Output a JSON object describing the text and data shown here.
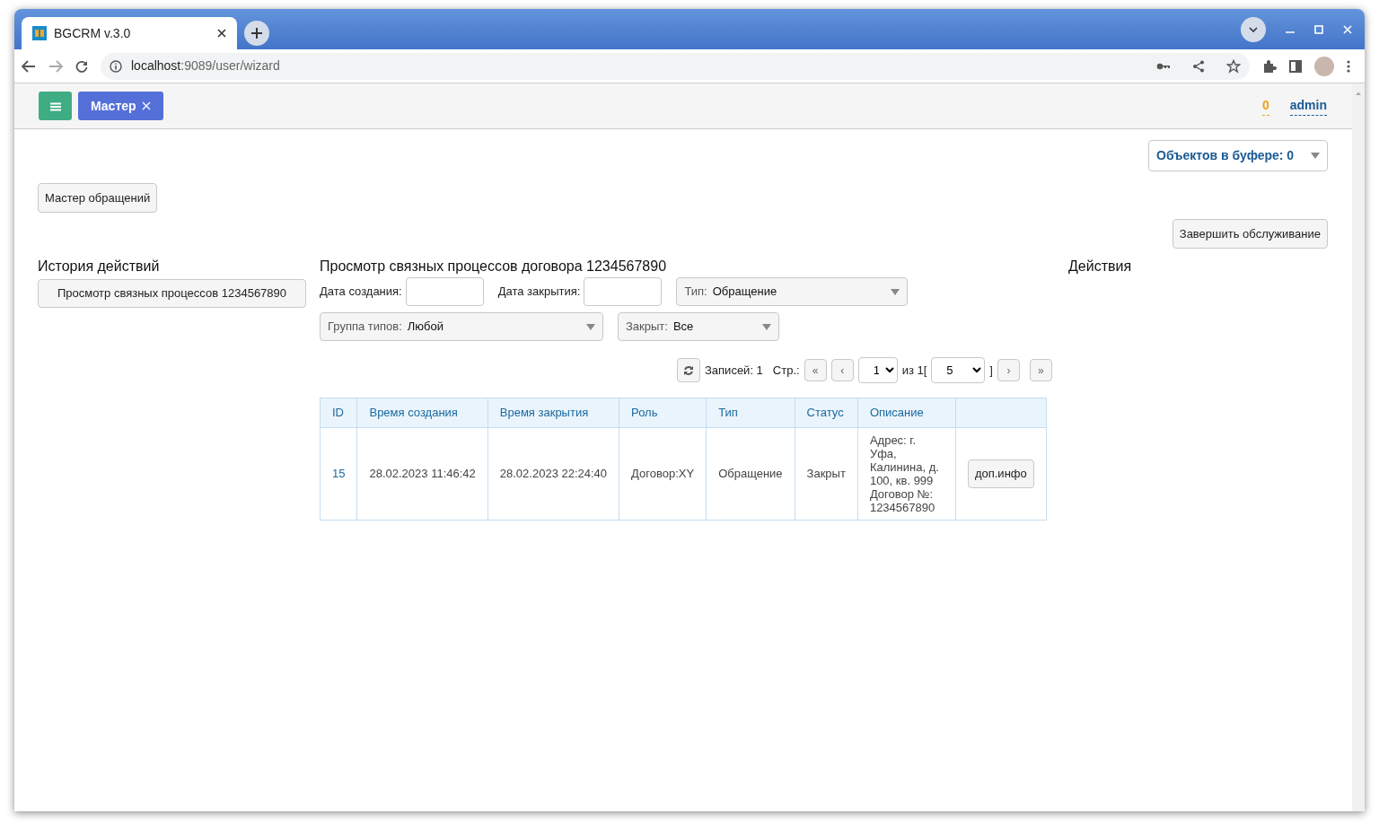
{
  "browser": {
    "tab_title": "BGCRM v.3.0",
    "url_host": "localhost",
    "url_path": ":9089/user/wizard"
  },
  "toolbar": {
    "tabs": [
      {
        "label": "Мастер",
        "selected": true
      }
    ],
    "counter": "0",
    "user": "admin"
  },
  "buffer": {
    "label": "Объектов в буфере: 0"
  },
  "wizard_button": "Мастер обращений",
  "finish_button": "Завершить обслуживание",
  "history": {
    "title": "История действий",
    "items": [
      "Просмотр связных процессов 1234567890"
    ]
  },
  "linked": {
    "title": "Просмотр связных процессов договора 1234567890",
    "filters": {
      "created_label": "Дата создания:",
      "closed_label": "Дата закрытия:",
      "selects": [
        {
          "label": "Тип:",
          "value": "Обращение"
        },
        {
          "label": "Группа типов:",
          "value": "Любой"
        },
        {
          "label": "Закрыт:",
          "value": "Все"
        }
      ]
    },
    "pager": {
      "records": "Записей: 1",
      "page_label": "Стр.:",
      "first": "«",
      "prev": "‹",
      "page": "1",
      "of": "из 1[",
      "size": "5",
      "close_bracket": "]",
      "next": "›",
      "last": "»"
    },
    "table": {
      "columns": [
        "ID",
        "Время создания",
        "Время закрытия",
        "Роль",
        "Тип",
        "Статус",
        "Описание"
      ],
      "rows": [
        {
          "id": "15",
          "created": "28.02.2023 11:46:42",
          "closed": "28.02.2023 22:24:40",
          "role": "Договор:XY",
          "type": "Обращение",
          "status": "Закрыт",
          "description": [
            "Адрес: г. Уфа, Калинина, д. 100, кв. 999",
            "Договор №: 1234567890"
          ],
          "action": "доп.инфо"
        }
      ]
    }
  },
  "actions": {
    "title": "Действия"
  }
}
